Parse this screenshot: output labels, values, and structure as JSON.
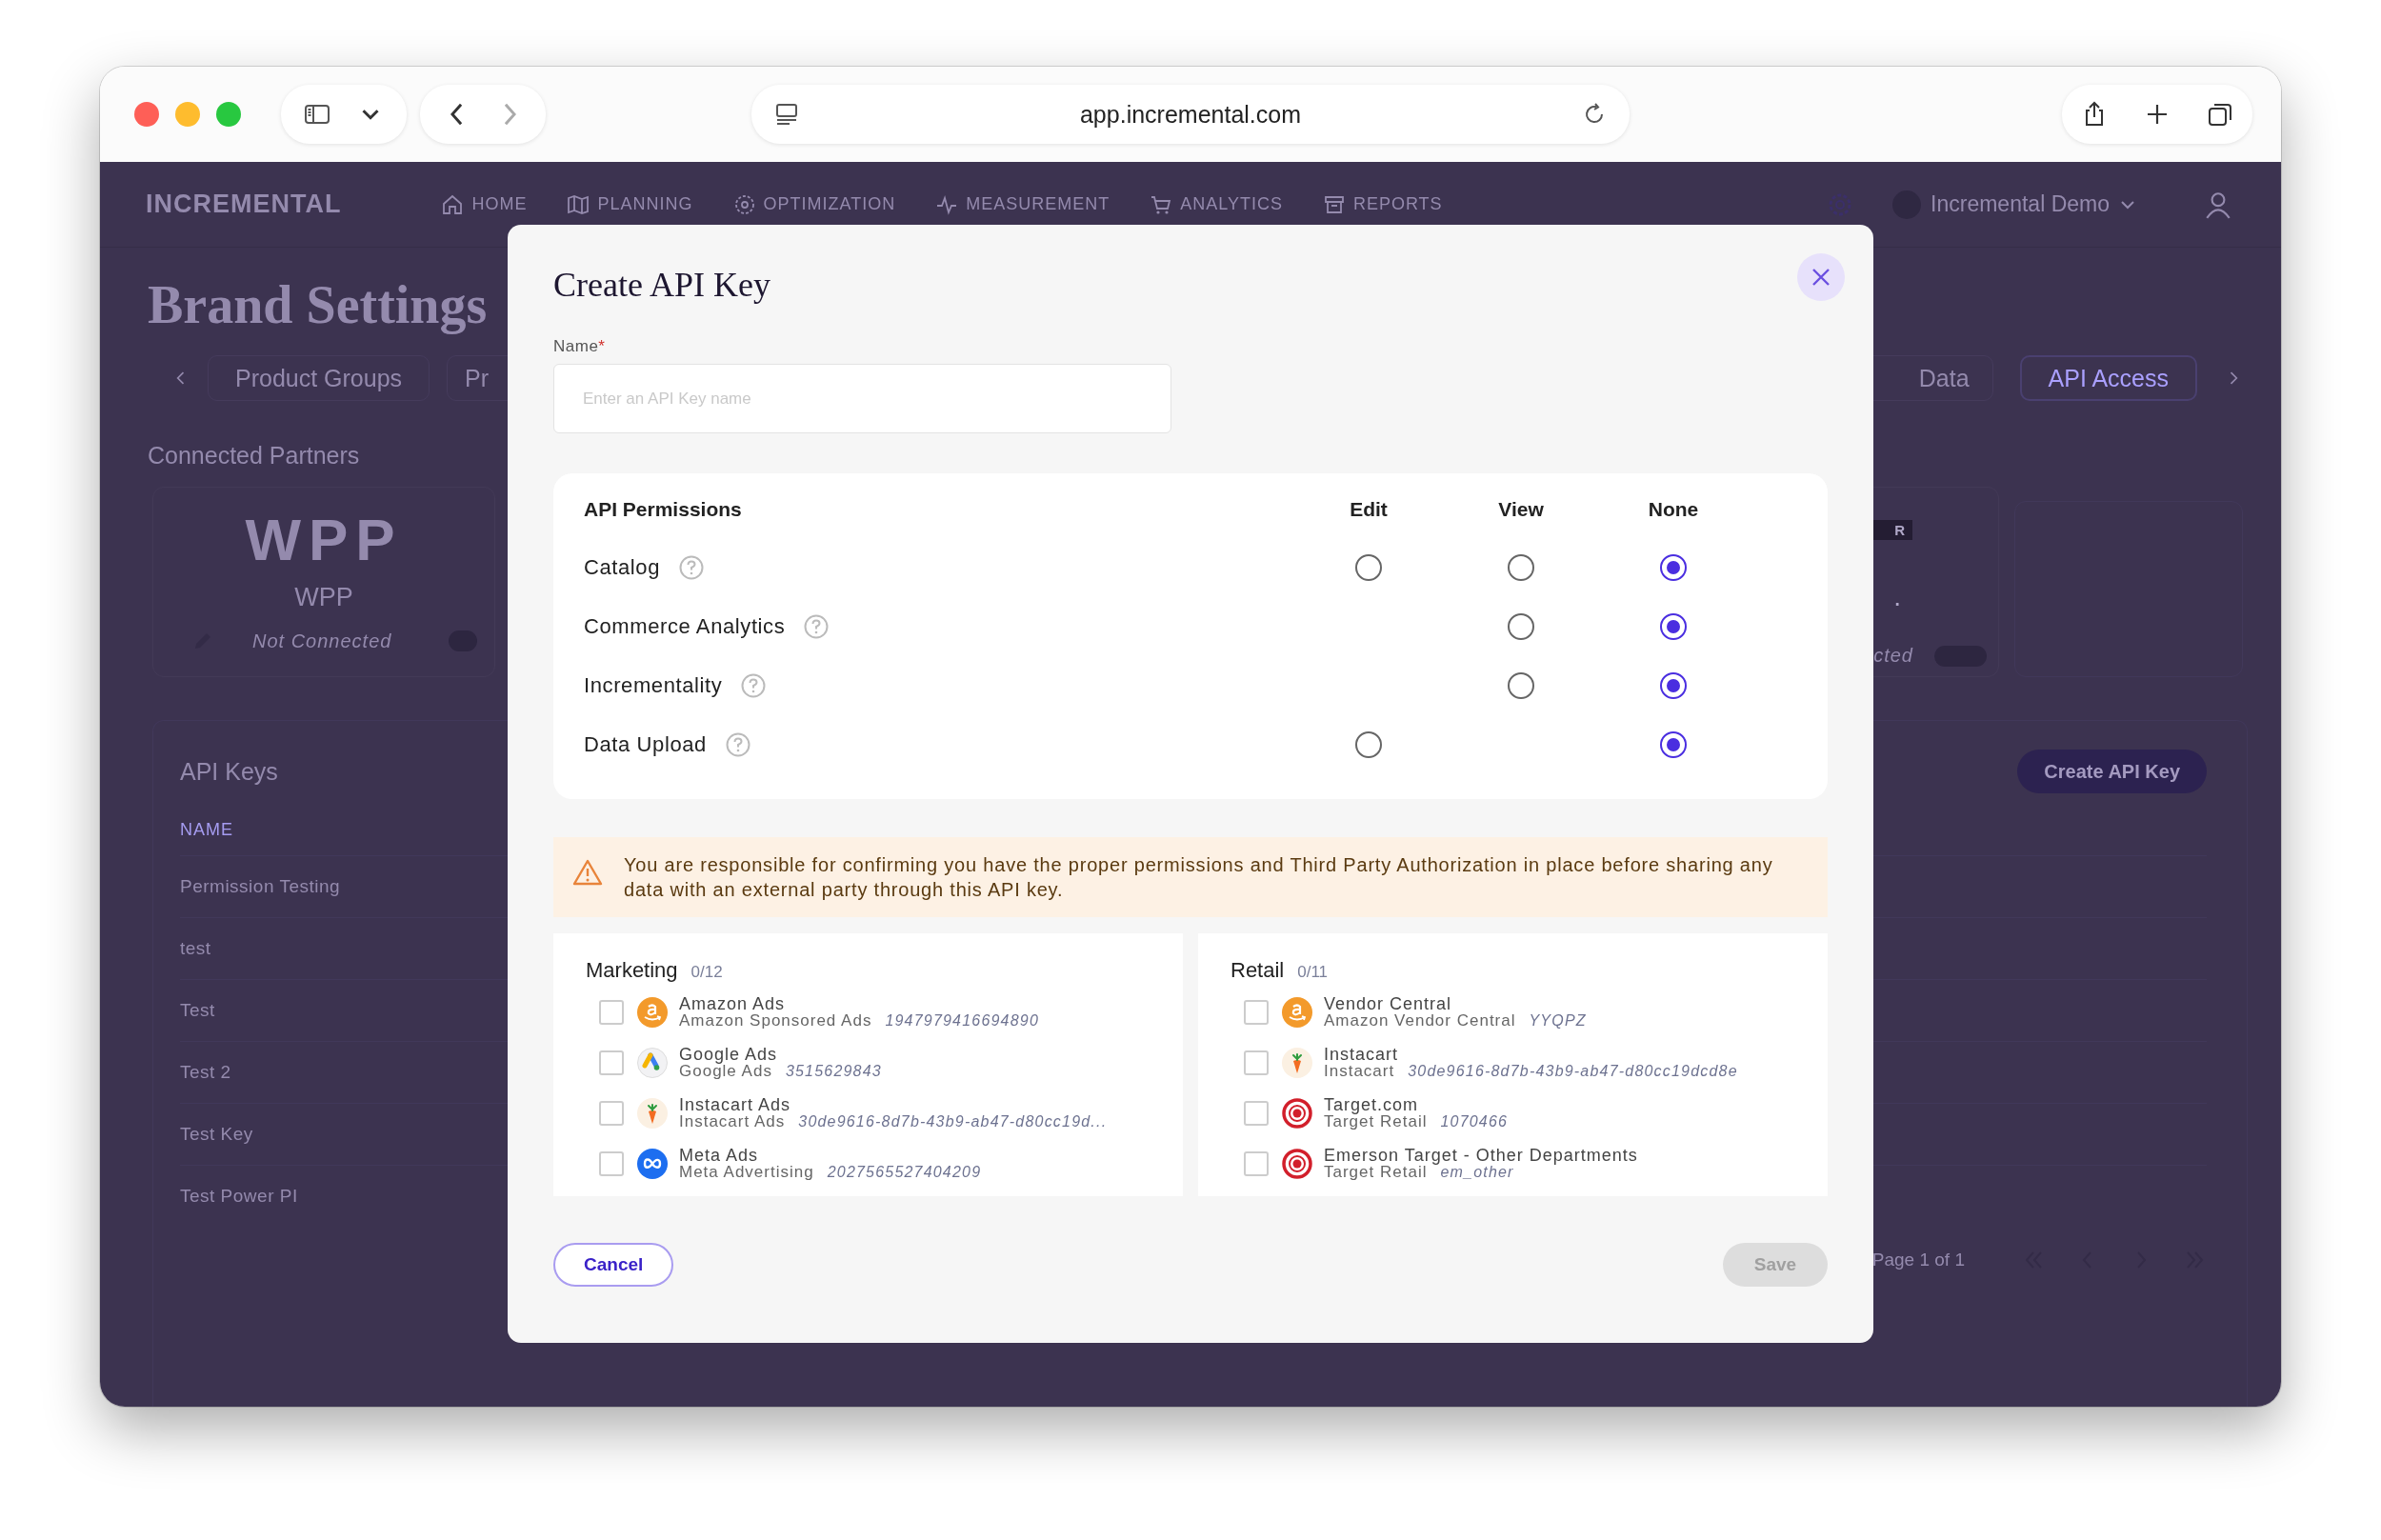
{
  "browser": {
    "url": "app.incremental.com"
  },
  "nav": {
    "logo": "INCREMENTAL",
    "items": [
      {
        "label": "HOME"
      },
      {
        "label": "PLANNING"
      },
      {
        "label": "OPTIMIZATION"
      },
      {
        "label": "MEASUREMENT"
      },
      {
        "label": "ANALYTICS"
      },
      {
        "label": "REPORTS"
      }
    ],
    "account": "Incremental Demo"
  },
  "page": {
    "title": "Brand Settings",
    "tabs_left": [
      {
        "label": "Product Groups",
        "selected": false
      },
      {
        "label": "Pr",
        "selected": false
      }
    ],
    "tabs_right": [
      {
        "label": "Data",
        "selected": false
      },
      {
        "label": "API Access",
        "selected": true
      }
    ],
    "section_title": "Connected Partners",
    "partners": [
      {
        "kind": "full",
        "logo_text": "WPP",
        "name": "WPP",
        "status": "Not Connected",
        "connected": false
      },
      {
        "kind": "partial",
        "badge": "R",
        "name": ".",
        "status": "cted",
        "connected": false
      },
      {
        "kind": "empty"
      }
    ],
    "api_keys": {
      "title": "API Keys",
      "create_button": "Create API Key",
      "column": "NAME",
      "rows": [
        "Permission Testing",
        "test",
        "Test",
        "Test 2",
        "Test Key",
        "Test Power PI"
      ],
      "pagination": "Page 1 of 1"
    }
  },
  "modal": {
    "title": "Create API Key",
    "name_field": {
      "label": "Name",
      "required_mark": "*",
      "placeholder": "Enter an API Key name"
    },
    "permissions": {
      "title": "API Permissions",
      "columns": [
        "Edit",
        "View",
        "None"
      ],
      "rows": [
        {
          "label": "Catalog",
          "options": [
            {
              "kind": "edit",
              "selected": false
            },
            {
              "kind": "view",
              "selected": false
            },
            {
              "kind": "none",
              "selected": true
            }
          ]
        },
        {
          "label": "Commerce Analytics",
          "options": [
            {
              "kind": "view",
              "selected": false
            },
            {
              "kind": "none",
              "selected": true
            }
          ]
        },
        {
          "label": "Incrementality",
          "options": [
            {
              "kind": "view",
              "selected": false
            },
            {
              "kind": "none",
              "selected": true
            }
          ]
        },
        {
          "label": "Data Upload",
          "options": [
            {
              "kind": "edit",
              "selected": false
            },
            {
              "kind": "none",
              "selected": true
            }
          ]
        }
      ]
    },
    "warning": "You are responsible for confirming you have the proper permissions and Third Party Authorization in place before sharing any data with an external party through this API key.",
    "groups": [
      {
        "title": "Marketing",
        "count": "0/12",
        "items": [
          {
            "name": "Amazon Ads",
            "product": "Amazon Sponsored Ads",
            "account": "1947979416694890",
            "kind": "amazon",
            "checked": false
          },
          {
            "name": "Google Ads",
            "product": "Google Ads",
            "account": "3515629843",
            "kind": "google",
            "checked": false
          },
          {
            "name": "Instacart Ads",
            "product": "Instacart Ads",
            "account": "30de9616-8d7b-43b9-ab47-d80cc19d...",
            "kind": "instacart",
            "checked": false
          },
          {
            "name": "Meta Ads",
            "product": "Meta Advertising",
            "account": "2027565527404209",
            "kind": "meta",
            "checked": false
          }
        ]
      },
      {
        "title": "Retail",
        "count": "0/11",
        "items": [
          {
            "name": "Vendor Central",
            "product": "Amazon Vendor Central",
            "account": "YYQPZ",
            "kind": "amazon",
            "checked": false
          },
          {
            "name": "Instacart",
            "product": "Instacart",
            "account": "30de9616-8d7b-43b9-ab47-d80cc19dcd8e",
            "kind": "instacart",
            "checked": false
          },
          {
            "name": "Target.com",
            "product": "Target Retail",
            "account": "1070466",
            "kind": "target",
            "checked": false
          },
          {
            "name": "Emerson Target - Other Departments",
            "product": "Target Retail",
            "account": "em_other",
            "kind": "target",
            "checked": false
          }
        ]
      }
    ],
    "cancel": "Cancel",
    "save": {
      "label": "Save",
      "disabled": true
    }
  }
}
